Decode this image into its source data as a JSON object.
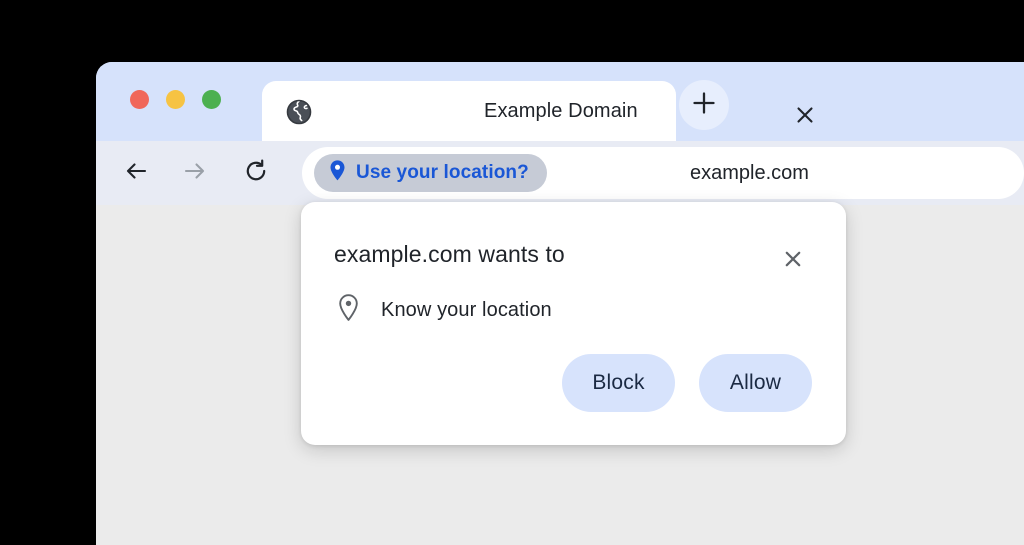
{
  "window": {
    "traffic_lights": [
      {
        "name": "close",
        "color": "#f0675a"
      },
      {
        "name": "minimize",
        "color": "#f6c343"
      },
      {
        "name": "zoom",
        "color": "#4cb050"
      }
    ]
  },
  "tabstrip": {
    "tab": {
      "title": "Example Domain",
      "favicon": "globe-icon",
      "close_icon": "close-icon"
    },
    "new_tab": {
      "icon": "plus-icon",
      "label": "+"
    }
  },
  "toolbar": {
    "back": {
      "icon": "arrow-left-icon",
      "enabled": true
    },
    "forward": {
      "icon": "arrow-right-icon",
      "enabled": false
    },
    "reload": {
      "icon": "reload-icon"
    },
    "omnibox": {
      "chip": {
        "icon": "location-pin-filled-icon",
        "label": "Use your location?"
      },
      "url": "example.com"
    }
  },
  "dialog": {
    "title": "example.com wants to",
    "close_icon": "close-icon",
    "permission": {
      "icon": "location-pin-outline-icon",
      "label": "Know your location"
    },
    "buttons": {
      "block": "Block",
      "allow": "Allow"
    }
  },
  "colors": {
    "titlebar": "#d6e2fb",
    "toolbar": "#e8ebf4",
    "page_background": "#ebebeb",
    "tab_background": "#ffffff",
    "chip_background": "#c6cbd6",
    "chip_text": "#1a57d6",
    "button_background": "#d7e3fc",
    "button_text": "#1b2a43",
    "desktop": "#000000"
  }
}
